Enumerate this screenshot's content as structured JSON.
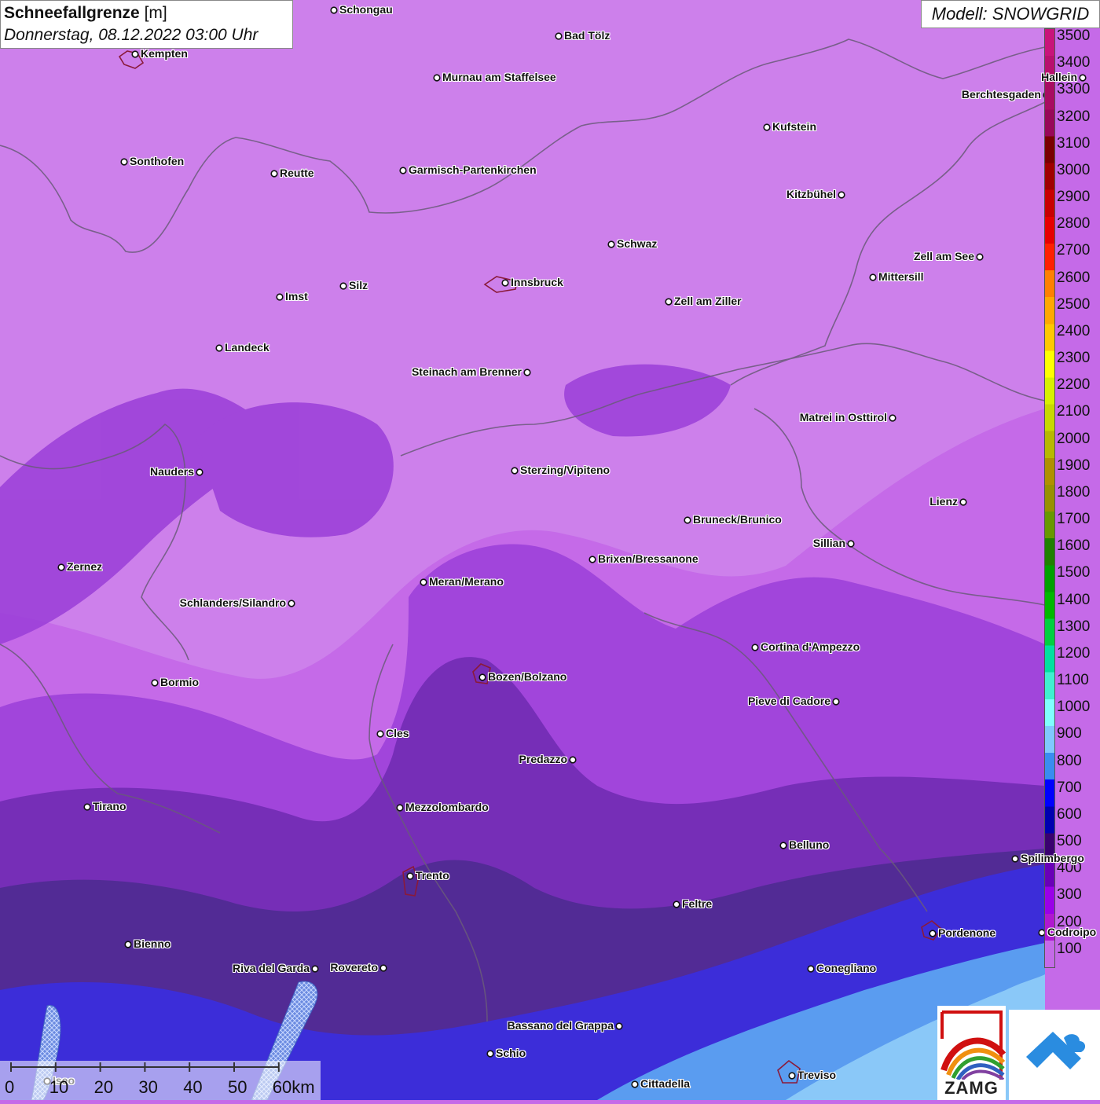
{
  "title": {
    "main": "Schneefallgrenze",
    "unit": "[m]",
    "datetime": "Donnerstag, 08.12.2022 03:00 Uhr"
  },
  "model": "Modell: SNOWGRID",
  "legend": {
    "labels": [
      "3500",
      "3400",
      "3300",
      "3200",
      "3100",
      "3000",
      "2900",
      "2800",
      "2700",
      "2600",
      "2500",
      "2400",
      "2300",
      "2200",
      "2100",
      "2000",
      "1900",
      "1800",
      "1700",
      "1600",
      "1500",
      "1400",
      "1300",
      "1200",
      "1100",
      "1000",
      "900",
      "800",
      "700",
      "600",
      "500",
      "400",
      "300",
      "200",
      "100"
    ],
    "colors": [
      "#c8147a",
      "#b8106e",
      "#a80c62",
      "#980858",
      "#7a0000",
      "#a00000",
      "#c80000",
      "#e60000",
      "#ff2000",
      "#ff8000",
      "#ffa800",
      "#ffc800",
      "#ffff00",
      "#d8f000",
      "#c8d800",
      "#b8b800",
      "#b09000",
      "#989000",
      "#689800",
      "#208000",
      "#00a000",
      "#00b800",
      "#00d040",
      "#00e0a0",
      "#40f0d0",
      "#80ffff",
      "#80c8ff",
      "#3a8cf0",
      "#0000ff",
      "#0000b0",
      "#3a0070",
      "#6a00b8",
      "#9a00e8",
      "#b018d0",
      "#c56ae8"
    ]
  },
  "cities": [
    {
      "name": "Schongau"
    },
    {
      "name": "Bad Tölz"
    },
    {
      "name": "Kempten"
    },
    {
      "name": "Murnau am Staffelsee"
    },
    {
      "name": "Berchtesgaden"
    },
    {
      "name": "Hallein"
    },
    {
      "name": "Kufstein"
    },
    {
      "name": "Sonthofen"
    },
    {
      "name": "Reutte"
    },
    {
      "name": "Garmisch-Partenkirchen"
    },
    {
      "name": "Kitzbühel"
    },
    {
      "name": "Schwaz"
    },
    {
      "name": "Zell am See"
    },
    {
      "name": "Innsbruck"
    },
    {
      "name": "Mittersill"
    },
    {
      "name": "Imst"
    },
    {
      "name": "Silz"
    },
    {
      "name": "Zell am Ziller"
    },
    {
      "name": "Landeck"
    },
    {
      "name": "Steinach am Brenner"
    },
    {
      "name": "Matrei in Osttirol"
    },
    {
      "name": "Nauders"
    },
    {
      "name": "Sterzing/Vipiteno"
    },
    {
      "name": "Lienz"
    },
    {
      "name": "Bruneck/Brunico"
    },
    {
      "name": "Sillian"
    },
    {
      "name": "Zernez"
    },
    {
      "name": "Brixen/Bressanone"
    },
    {
      "name": "Meran/Merano"
    },
    {
      "name": "Schlanders/Silandro"
    },
    {
      "name": "Cortina d'Ampezzo"
    },
    {
      "name": "Bozen/Bolzano"
    },
    {
      "name": "Bormio"
    },
    {
      "name": "Pieve di Cadore"
    },
    {
      "name": "Cles"
    },
    {
      "name": "Predazzo"
    },
    {
      "name": "Tirano"
    },
    {
      "name": "Mezzolombardo"
    },
    {
      "name": "Belluno"
    },
    {
      "name": "Spilimbergo"
    },
    {
      "name": "Trento"
    },
    {
      "name": "Feltre"
    },
    {
      "name": "Pordenone"
    },
    {
      "name": "Codroipo"
    },
    {
      "name": "Bienno"
    },
    {
      "name": "Riva del Garda"
    },
    {
      "name": "Rovereto"
    },
    {
      "name": "Conegliano"
    },
    {
      "name": "Bassano del Grappa"
    },
    {
      "name": "Schio"
    },
    {
      "name": "Iseo"
    },
    {
      "name": "Treviso"
    },
    {
      "name": "Cittadella"
    }
  ],
  "scale": {
    "ticks": [
      "0",
      "10",
      "20",
      "30",
      "40",
      "50",
      "60km"
    ]
  },
  "logos": {
    "zamg": "ZAMG"
  }
}
